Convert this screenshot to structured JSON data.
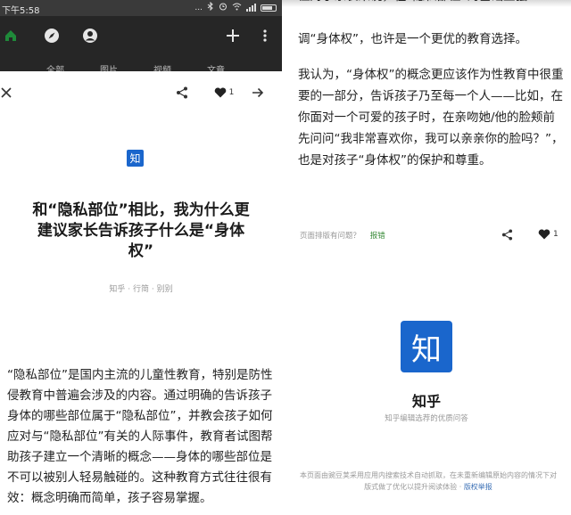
{
  "status_bar": {
    "time": "下午5:58",
    "dots": "..."
  },
  "nav_tabs": [
    "全部",
    "图片",
    "视频",
    "文章"
  ],
  "article_toolbar": {
    "like_count": "1"
  },
  "article": {
    "source_badge": "知",
    "title": "和“隐私部位”相比，我为什么更建议家长告诉孩子什么是“身体权”",
    "meta": "知乎 · 行简 · 别别",
    "intro": "“隐私部位”是国内主流的儿童性教育，特别是防性侵教育中普遍会涉及的内容。通过明确的告诉孩子身体的哪些部位属于“隐私部位”，并教会孩子如何应对与“隐私部位”有关的人际事件，教育者试图帮助孩子建立一个清晰的概念——身体的哪些部位是不可以被别人轻易触碰的。这种教育方式往往很有效：概念明确而简单，孩子容易掌握。"
  },
  "continuation": {
    "clipped_line": "但对于家长来说，在“隐私部位”的基础上强",
    "para1": "调“身体权”，也许是一个更优的教育选择。",
    "para2": "我认为，“身体权”的概念更应该作为性教育中很重要的一部分，告诉孩子乃至每一个人——比如，在你面对一个可爱的孩子时，在亲吻她/他的脸颊前先问问“我非常喜欢你，我可以亲亲你的脸吗？”，也是对孩子“身体权”的保护和尊重。",
    "feedback_text": "页面排版有问题？",
    "feedback_link": "报错",
    "like_count": "1"
  },
  "footer": {
    "logo": "知",
    "brand": "知乎",
    "tagline": "知乎编辑选荐的优质问答",
    "disclaimer": "本页面由豌豆荚采用应用内搜索技术自动抓取，在未重新编辑原始内容的情况下对版式做了优化以提升阅读体验 · ",
    "report_link": "版权举报"
  },
  "colors": {
    "brand_blue": "#1a66cc",
    "app_bar": "#262626",
    "link_green": "#3a8c3a"
  },
  "icons": [
    "home-icon",
    "compass-icon",
    "profile-icon",
    "plus-icon",
    "more-vert-icon",
    "close-icon",
    "share-icon",
    "heart-icon",
    "arrow-right-icon"
  ]
}
